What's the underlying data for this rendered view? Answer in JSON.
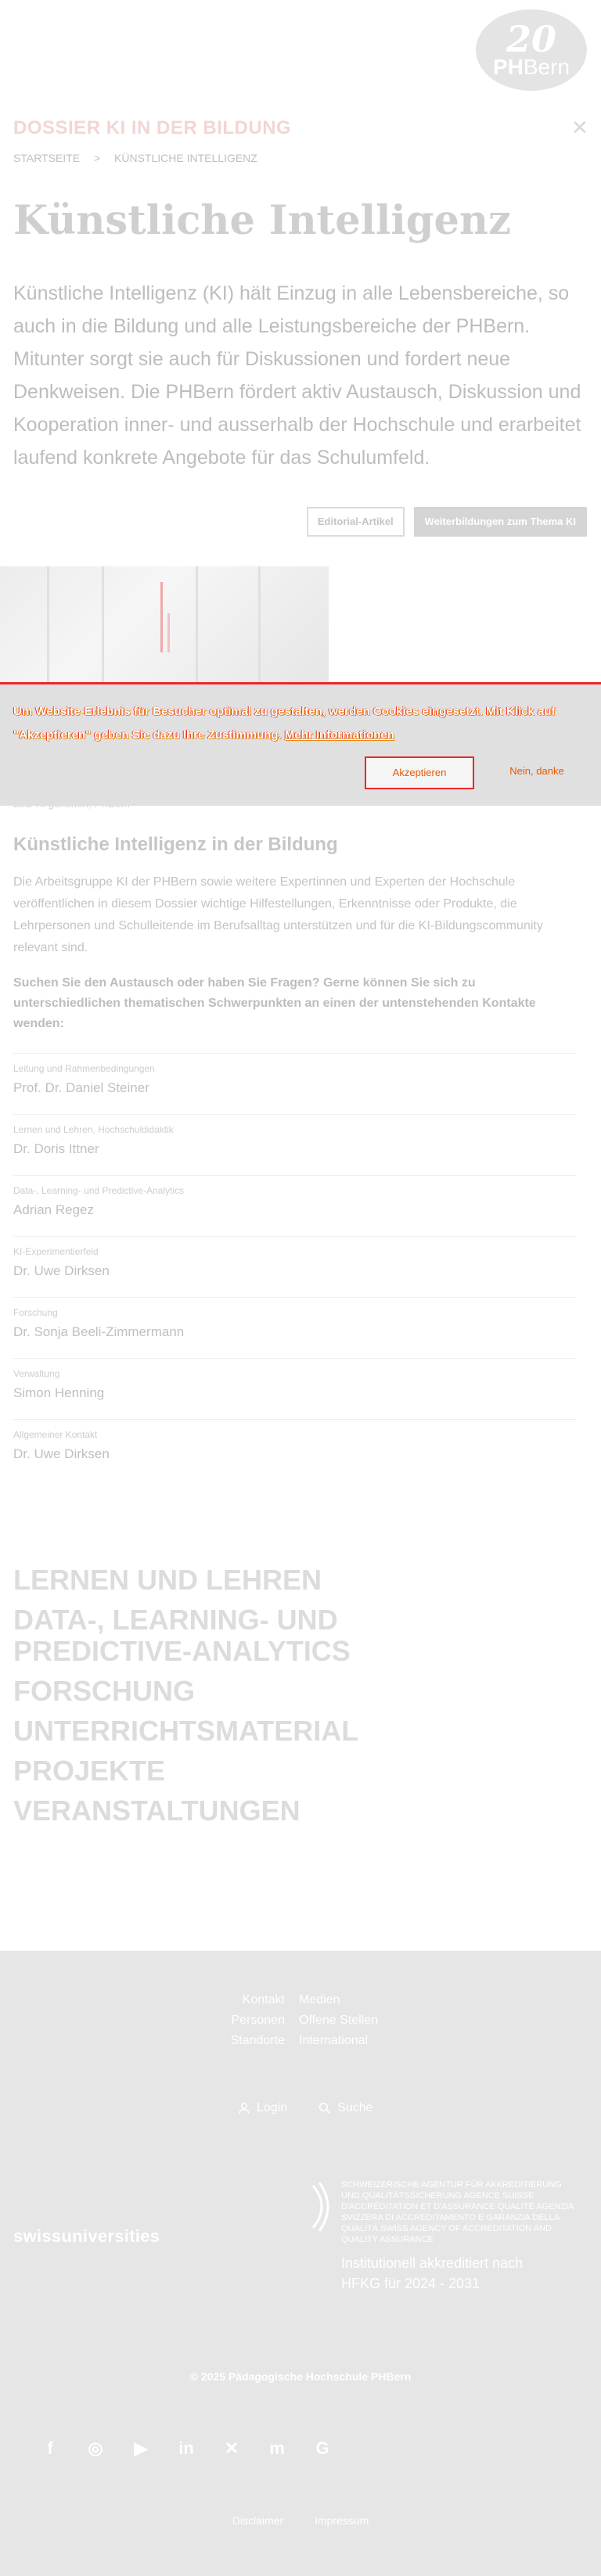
{
  "header": {
    "logo_number": "20",
    "logo_ph": "PH",
    "logo_bern": "Bern",
    "dossier_label": "Dossier KI in der Bildung",
    "close_icon": "close-icon"
  },
  "breadcrumb": {
    "home": "Startseite",
    "separator": ">",
    "current": "Künstliche Intelligenz"
  },
  "page": {
    "title": "Künstliche Intelligenz",
    "lead": "Künstliche Intelligenz (KI) hält Einzug in alle Lebensbereiche, so auch in die Bildung und alle Leistungsbereiche der PHBern. Mitunter sorgt sie auch für Diskussionen und fordert neue Denkweisen. Die PHBern fördert aktiv Austausch, Diskussion und Kooperation inner- und ausserhalb der Hochschule und erarbeitet laufend konkrete Angebote für das Schulumfeld.",
    "button_editorial": "Editorial-Artikel",
    "button_weiterbildung": "Weiterbildungen zum Thema KI",
    "image_caption": "Bild: KI generiert, PHBern"
  },
  "cookie": {
    "text": "Um Website-Erlebnis für Besucher optimal zu gestalten, werden Cookies eingesetzt. Mit Klick auf \"Akzeptieren\" geben Sie dazu Ihre Zustimmung.",
    "link": "Mehr Informationen",
    "accept": "Akzeptieren",
    "decline": "Nein, danke"
  },
  "section": {
    "title": "Künstliche Intelligenz in der Bildung",
    "body": "Die Arbeitsgruppe KI der PHBern sowie weitere Expertinnen und Experten der Hochschule veröffentlichen in diesem Dossier wichtige Hilfestellungen, Erkenntnisse oder Produkte, die Lehrpersonen und Schulleitende im Berufsalltag unterstützen und für die KI-Bildungscommunity relevant sind.",
    "question": "Suchen Sie den Austausch oder haben Sie Fragen? Gerne können Sie sich zu unterschiedlichen thematischen Schwerpunkten an einen der untenstehenden Kontakte wenden:"
  },
  "contacts": [
    {
      "role": "Leitung und Rahmenbedingungen",
      "name": "Prof. Dr. Daniel Steiner"
    },
    {
      "role": "Lernen und Lehren, Hochschuldidaktik",
      "name": "Dr. Doris Ittner"
    },
    {
      "role": "Data-, Learning- und Predictive-Analytics",
      "name": "Adrian Regez"
    },
    {
      "role": "KI-Experimentierfeld",
      "name": "Dr. Uwe Dirksen"
    },
    {
      "role": "Forschung",
      "name": "Dr. Sonja Beeli-Zimmermann"
    },
    {
      "role": "Verwaltung",
      "name": "Simon Henning"
    },
    {
      "role": "Allgemeiner Kontakt",
      "name": "Dr. Uwe Dirksen"
    }
  ],
  "topics": [
    "Lernen und Lehren",
    "Data-, Learning- und Predictive-Analytics",
    "Forschung",
    "Unterrichtsmaterial",
    "Projekte",
    "Veranstaltungen"
  ],
  "footer": {
    "nav": [
      {
        "left": "Kontakt",
        "right": "Medien"
      },
      {
        "left": "Personen",
        "right": "Offene Stellen"
      },
      {
        "left": "Standorte",
        "right": "International"
      }
    ],
    "login": "Login",
    "search": "Suche",
    "swissuniversities": "swissuniversities",
    "aaq_text": "Schweizerische Agentur für Akkreditierung und Qualitätssicherung Agence suisse d'accréditation et d'assurance qualité Agenzia svizzera di accreditamento e garanzia della qualità Swiss Agency of Accreditation and Quality Assurance",
    "accreditation_line1": "Institutionell akkreditiert nach",
    "accreditation_line2": "HFKG für 2024 - 2031",
    "copyright": "© 2025 Pädagogische Hochschule PHBern",
    "social": [
      "facebook-icon",
      "instagram-icon",
      "youtube-icon",
      "linkedin-icon",
      "xing-icon",
      "mastodon-icon",
      "google-icon"
    ],
    "link_disclaimer": "Disclaimer",
    "link_impressum": "Impressum"
  }
}
